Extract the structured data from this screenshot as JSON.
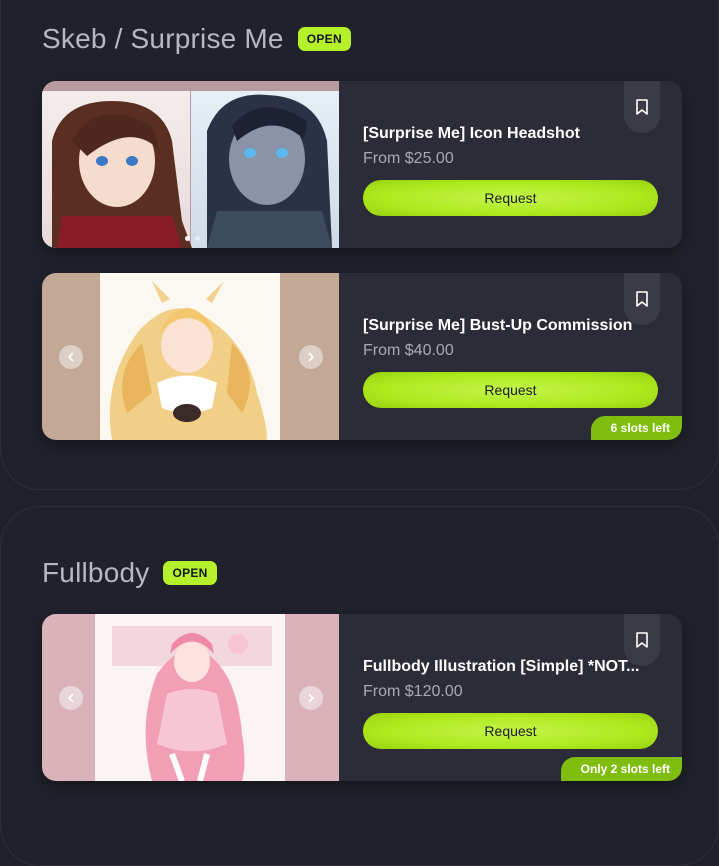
{
  "sections": [
    {
      "title": "Skeb / Surprise Me",
      "badge": "OPEN",
      "cards": [
        {
          "title": "[Surprise Me] Icon Headshot",
          "price": "From $25.00",
          "button": "Request",
          "slots": ""
        },
        {
          "title": "[Surprise Me] Bust-Up Commission",
          "price": "From $40.00",
          "button": "Request",
          "slots": "6 slots left"
        }
      ]
    },
    {
      "title": "Fullbody",
      "badge": "OPEN",
      "cards": [
        {
          "title": "Fullbody Illustration [Simple] *NOT...",
          "price": "From $120.00",
          "button": "Request",
          "slots": "Only 2 slots left"
        }
      ]
    }
  ],
  "icons": {
    "bookmark": "bookmark-icon",
    "prev": "chevron-left-icon",
    "next": "chevron-right-icon"
  },
  "colors": {
    "accent": "#b4f12a",
    "slots_badge": "#7fbe0e",
    "card_bg": "#2b2c37",
    "page_bg": "#1f2029"
  }
}
